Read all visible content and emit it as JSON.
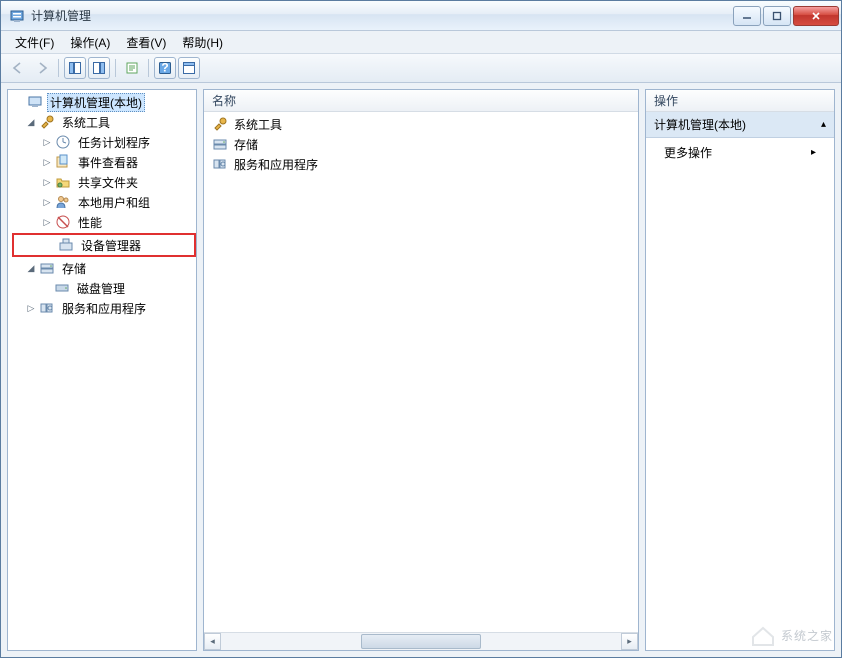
{
  "titlebar": {
    "title": "计算机管理"
  },
  "menubar": {
    "file": "文件(F)",
    "action": "操作(A)",
    "view": "查看(V)",
    "help": "帮助(H)"
  },
  "tree": {
    "root": "计算机管理(本地)",
    "system_tools": "系统工具",
    "task_scheduler": "任务计划程序",
    "event_viewer": "事件查看器",
    "shared_folders": "共享文件夹",
    "local_users": "本地用户和组",
    "performance": "性能",
    "device_manager": "设备管理器",
    "storage": "存储",
    "disk_management": "磁盘管理",
    "services_apps": "服务和应用程序"
  },
  "middle": {
    "header": "名称",
    "items": {
      "system_tools": "系统工具",
      "storage": "存储",
      "services_apps": "服务和应用程序"
    }
  },
  "right": {
    "header": "操作",
    "section_title": "计算机管理(本地)",
    "more_actions": "更多操作"
  },
  "watermark": "系统之家"
}
